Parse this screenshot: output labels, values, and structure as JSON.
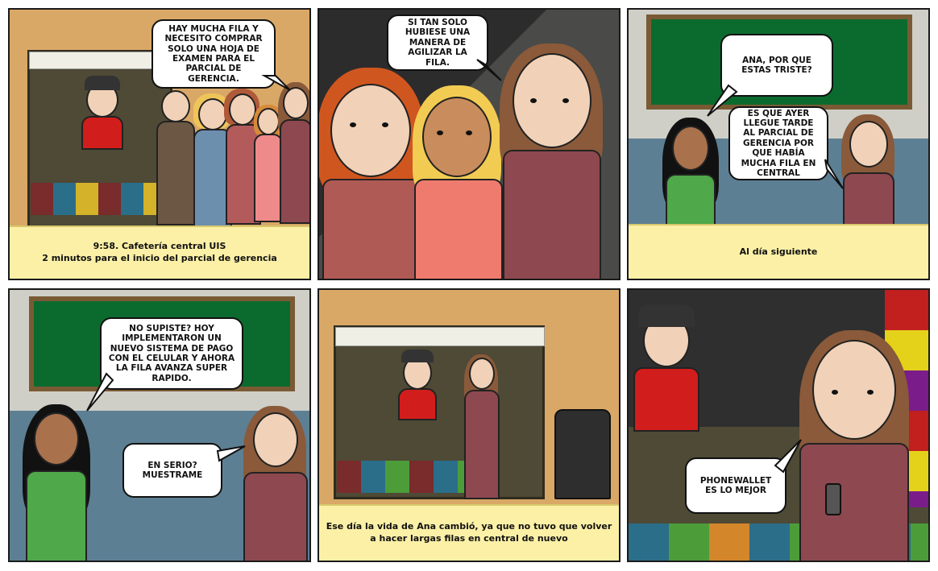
{
  "panels": [
    {
      "bubbles": [
        "Hay mucha fila y necesito comprar solo una hoja de examen para el parcial de gerencia."
      ],
      "caption": "9:58. Cafetería central UIS\n2 minutos para el inicio del parcial de gerencia"
    },
    {
      "bubbles": [
        "Si tan solo hubiese una manera de agilizar la fila."
      ],
      "caption": ""
    },
    {
      "bubbles": [
        "Ana, por que estas triste?",
        "Es que ayer llegue tarde al parcial de gerencia por que había mucha fila en central"
      ],
      "caption": "Al día siguiente"
    },
    {
      "bubbles": [
        "No supiste? Hoy implementaron un nuevo sistema de pago con el celular y ahora la fila avanza super rapido.",
        "En serio? Muestrame"
      ],
      "caption": ""
    },
    {
      "bubbles": [],
      "caption": "Ese día la vida de Ana cambió, ya que no tuvo que volver\na hacer largas filas en central de nuevo"
    },
    {
      "bubbles": [
        "PhoneWallet es lo mejor"
      ],
      "caption": ""
    }
  ]
}
